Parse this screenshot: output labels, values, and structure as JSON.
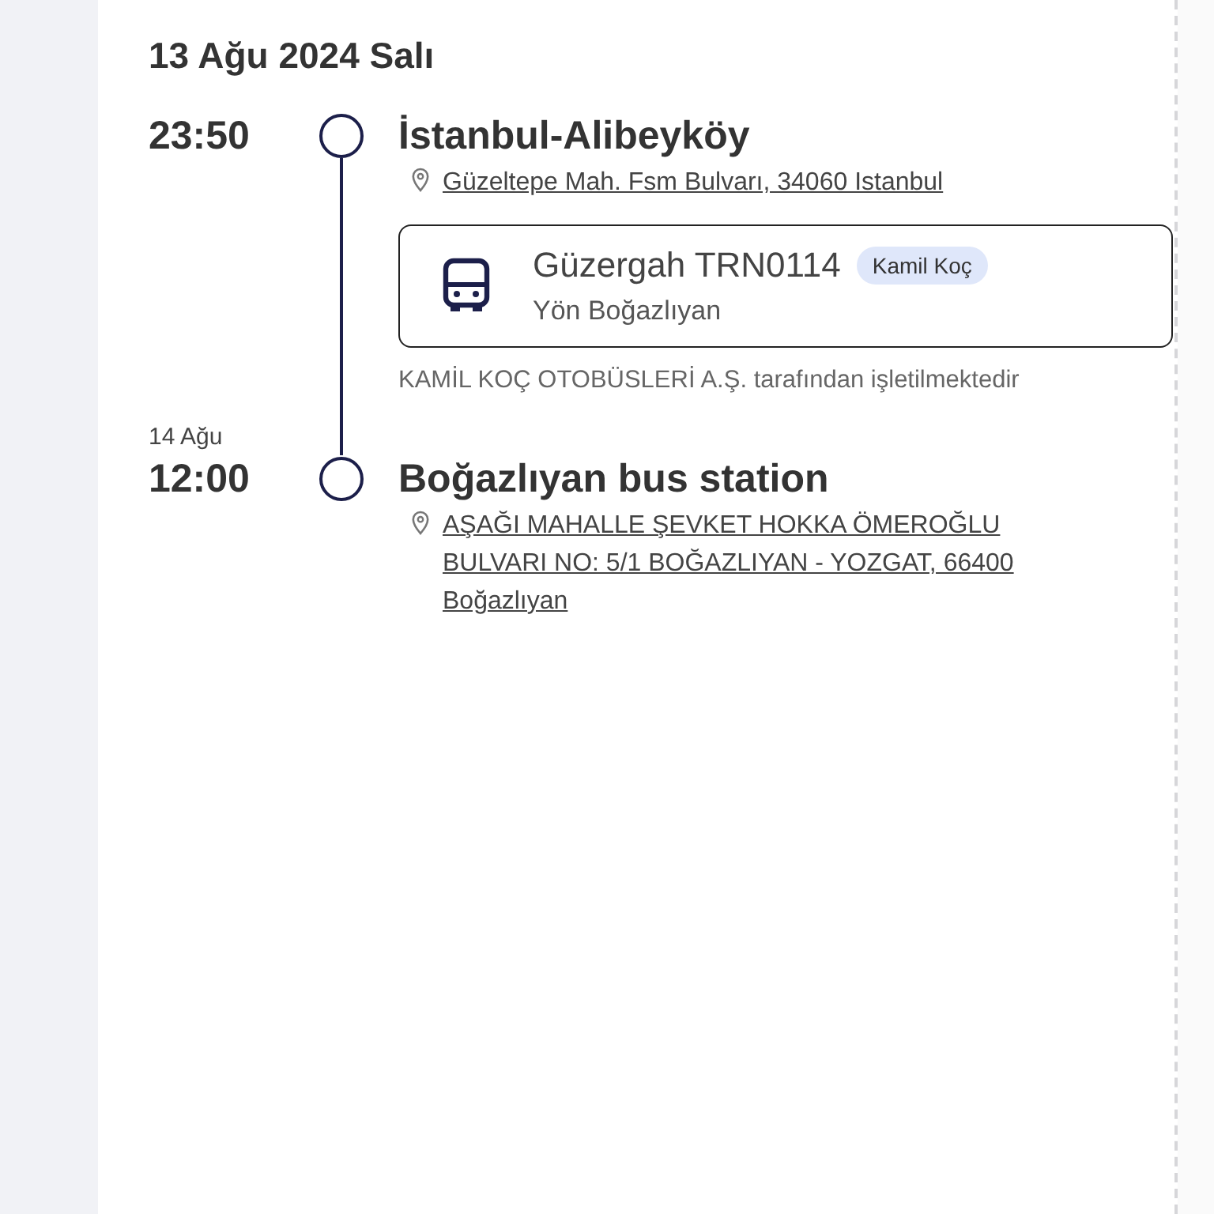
{
  "date_heading": "13 Ağu 2024 Salı",
  "timeline": [
    {
      "kind": "stop",
      "time": "23:50",
      "name": "İstanbul-Alibeyköy",
      "address": "Güzeltepe Mah. Fsm Bulvarı, 34060 Istanbul"
    },
    {
      "kind": "leg",
      "route": "Güzergah TRN0114",
      "badge": "Kamil Koç",
      "direction": "Yön Boğazlıyan",
      "operator_note": "KAMİL KOÇ OTOBÜSLERİ A.Ş. tarafından işletilmektedir"
    },
    {
      "kind": "stop",
      "date": "14 Ağu",
      "time": "12:00",
      "name": "Boğazlıyan bus station",
      "address": "AŞAĞI MAHALLE ŞEVKET HOKKA ÖMEROĞLU BULVARI NO: 5/1 BOĞAZLIYAN - YOZGAT, 66400 Boğazlıyan"
    }
  ]
}
